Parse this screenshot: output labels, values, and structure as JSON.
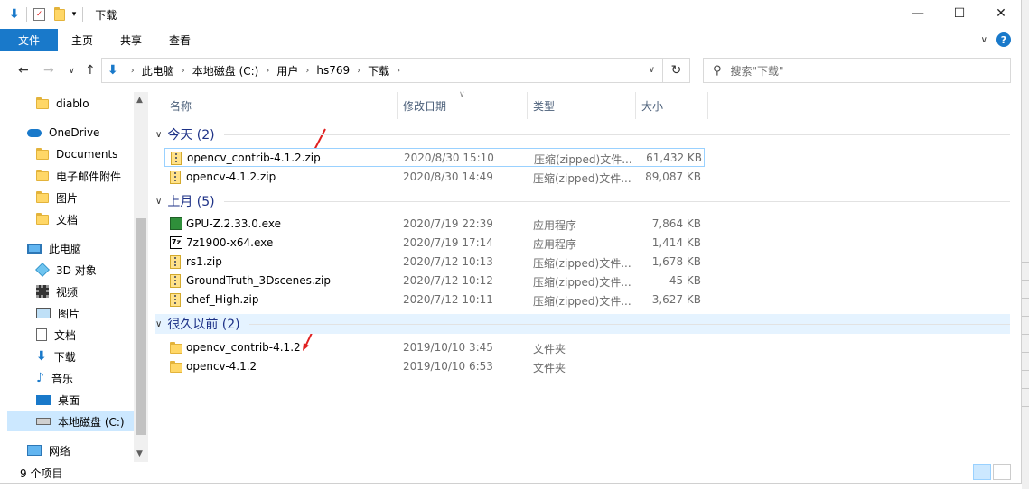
{
  "window": {
    "title": "下载",
    "controls": [
      "—",
      "☐",
      "✕"
    ]
  },
  "ribbon": {
    "tabs": [
      "文件",
      "主页",
      "共享",
      "查看"
    ]
  },
  "address": {
    "crumbs": [
      "此电脑",
      "本地磁盘 (C:)",
      "用户",
      "hs769",
      "下载"
    ],
    "search_placeholder": "搜索\"下载\""
  },
  "nav": {
    "items": [
      {
        "label": "diablo",
        "icon": "folder-icon"
      },
      {
        "label": "OneDrive",
        "icon": "cloud-icon"
      },
      {
        "label": "Documents",
        "icon": "folder-icon"
      },
      {
        "label": "电子邮件附件",
        "icon": "folder-icon"
      },
      {
        "label": "图片",
        "icon": "folder-icon"
      },
      {
        "label": "文档",
        "icon": "folder-icon"
      },
      {
        "label": "此电脑",
        "icon": "pc-icon"
      },
      {
        "label": "3D 对象",
        "icon": "cube-icon"
      },
      {
        "label": "视频",
        "icon": "film-icon"
      },
      {
        "label": "图片",
        "icon": "picture-icon"
      },
      {
        "label": "文档",
        "icon": "document-icon"
      },
      {
        "label": "下载",
        "icon": "download-icon"
      },
      {
        "label": "音乐",
        "icon": "music-icon"
      },
      {
        "label": "桌面",
        "icon": "desktop-icon"
      },
      {
        "label": "本地磁盘 (C:)",
        "icon": "disk-icon"
      },
      {
        "label": "网络",
        "icon": "network-icon"
      }
    ]
  },
  "columns": [
    "名称",
    "修改日期",
    "类型",
    "大小"
  ],
  "groups": [
    {
      "label": "今天 (2)",
      "files": [
        {
          "name": "opencv_contrib-4.1.2.zip",
          "date": "2020/8/30 15:10",
          "type": "压缩(zipped)文件...",
          "size": "61,432 KB",
          "icon": "zip-icon"
        },
        {
          "name": "opencv-4.1.2.zip",
          "date": "2020/8/30 14:49",
          "type": "压缩(zipped)文件...",
          "size": "89,087 KB",
          "icon": "zip-icon"
        }
      ]
    },
    {
      "label": "上月 (5)",
      "files": [
        {
          "name": "GPU-Z.2.33.0.exe",
          "date": "2020/7/19 22:39",
          "type": "应用程序",
          "size": "7,864 KB",
          "icon": "gpu-z-icon"
        },
        {
          "name": "7z1900-x64.exe",
          "date": "2020/7/19 17:14",
          "type": "应用程序",
          "size": "1,414 KB",
          "icon": "7zip-icon",
          "icon_text": "7z"
        },
        {
          "name": "rs1.zip",
          "date": "2020/7/12 10:13",
          "type": "压缩(zipped)文件...",
          "size": "1,678 KB",
          "icon": "zip-icon"
        },
        {
          "name": "GroundTruth_3Dscenes.zip",
          "date": "2020/7/12 10:12",
          "type": "压缩(zipped)文件...",
          "size": "45 KB",
          "icon": "zip-icon"
        },
        {
          "name": "chef_High.zip",
          "date": "2020/7/12 10:11",
          "type": "压缩(zipped)文件...",
          "size": "3,627 KB",
          "icon": "zip-icon"
        }
      ]
    },
    {
      "label": "很久以前 (2)",
      "files": [
        {
          "name": "opencv_contrib-4.1.2",
          "date": "2019/10/10 3:45",
          "type": "文件夹",
          "size": "",
          "icon": "folder-icon"
        },
        {
          "name": "opencv-4.1.2",
          "date": "2019/10/10 6:53",
          "type": "文件夹",
          "size": "",
          "icon": "folder-icon"
        }
      ]
    }
  ],
  "status": {
    "count": "9 个项目"
  },
  "colors": {
    "accent": "#1979ca",
    "selection": "#cce8ff",
    "group_text": "#1e3287",
    "annotation_arrow": "#e02020"
  }
}
